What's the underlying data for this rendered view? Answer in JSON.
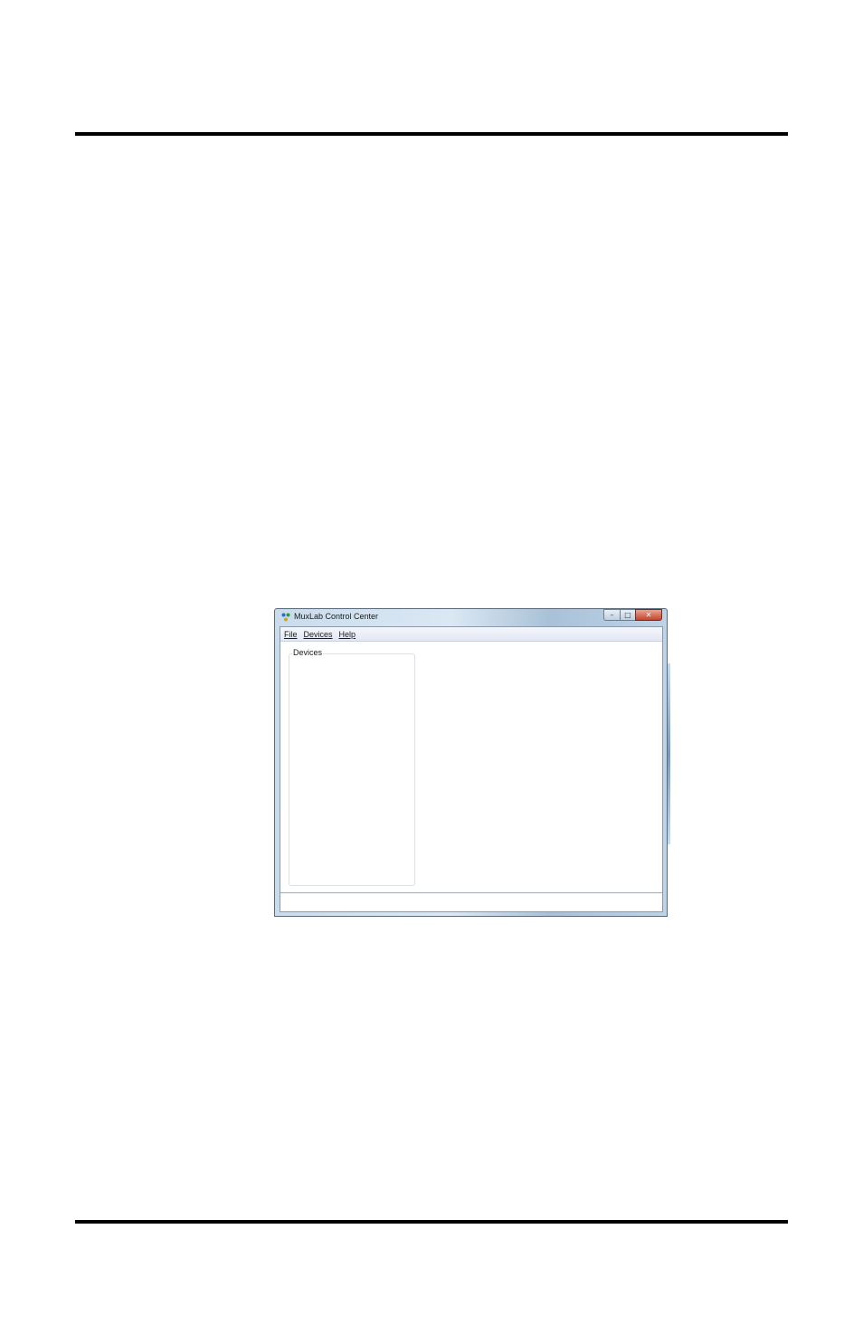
{
  "window": {
    "title": "MuxLab Control Center",
    "icon": "muxlab-app-icon",
    "caption_buttons": {
      "minimize_icon": "minimize-icon",
      "maximize_icon": "maximize-icon",
      "close_icon": "close-icon"
    }
  },
  "menu": {
    "items": [
      {
        "label": "File"
      },
      {
        "label": "Devices"
      },
      {
        "label": "Help"
      }
    ]
  },
  "devices_panel": {
    "label": "Devices"
  },
  "colors": {
    "rule": "#000000",
    "titlebar": "#c9dcec",
    "close_button": "#c2452d"
  }
}
